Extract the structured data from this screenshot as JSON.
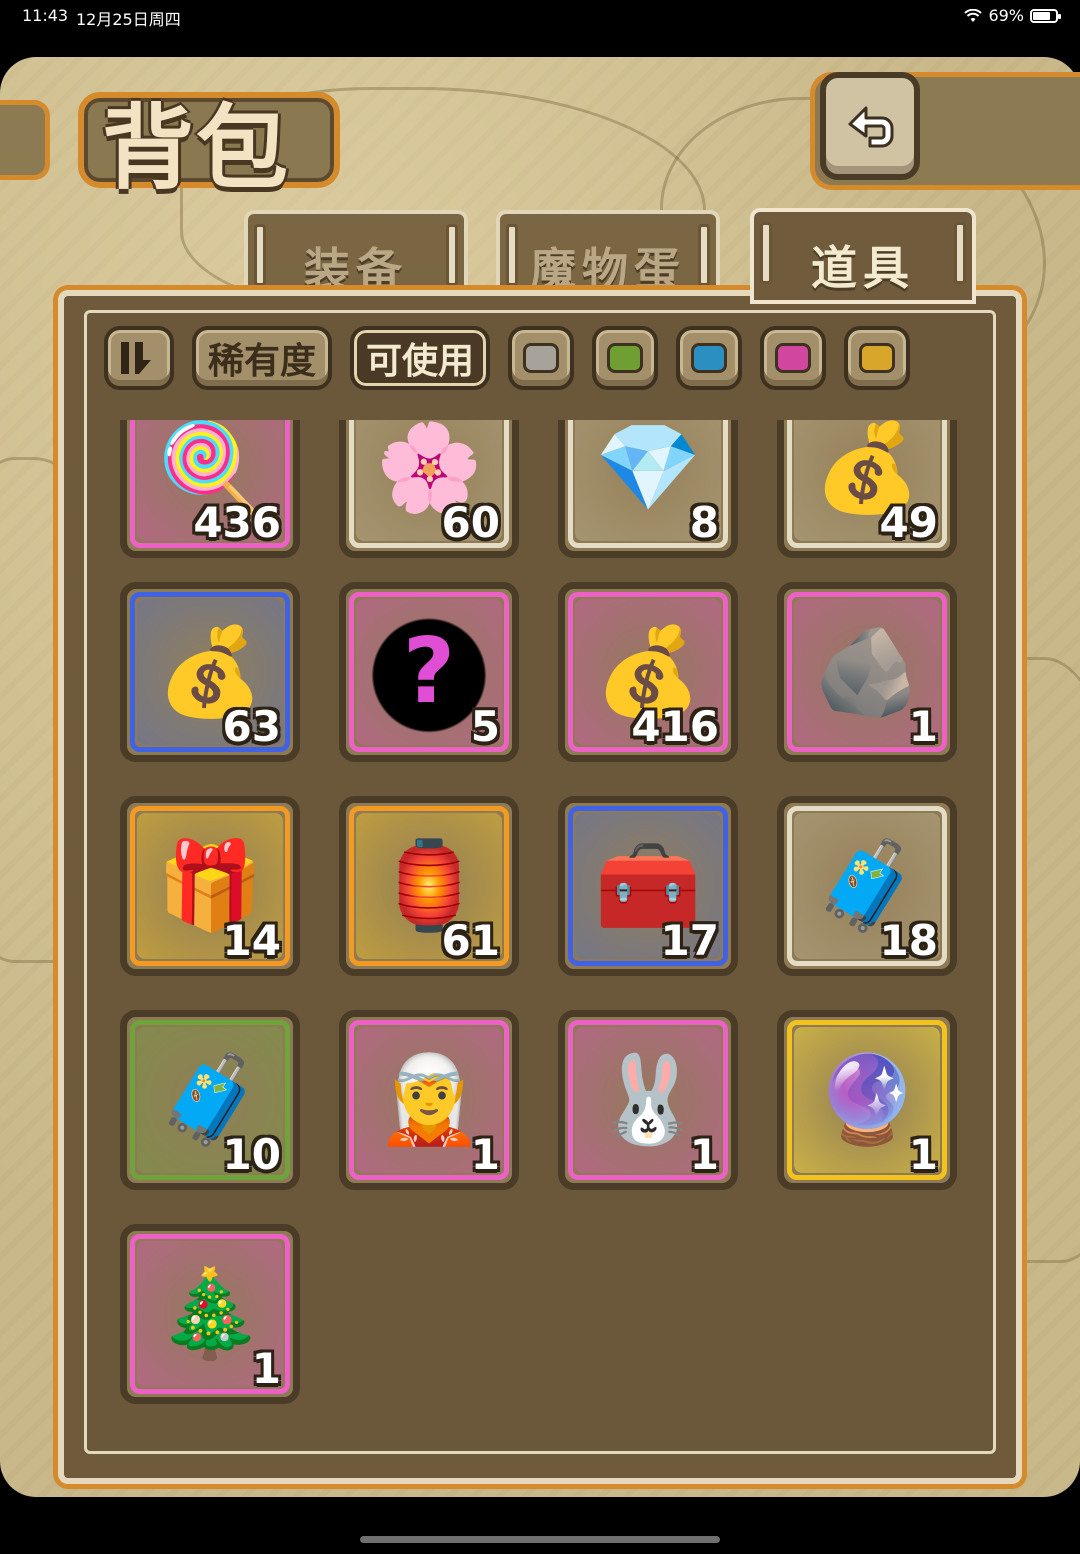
{
  "status_bar": {
    "time": "11:43",
    "date": "12月25日周四",
    "battery": "69%",
    "battery_level": 0.69
  },
  "header": {
    "title": "背包",
    "back_button": "back-arrow-icon"
  },
  "tabs": [
    {
      "label": "装备",
      "active": false
    },
    {
      "label": "魔物蛋",
      "active": false
    },
    {
      "label": "道具",
      "active": true
    }
  ],
  "filters": {
    "sort_icon": "sort-toggle-icon",
    "rarity_label": "稀有度",
    "usable_label": "可使用",
    "usable_active": true,
    "rarity_colors": [
      "#a7a39a",
      "#6f9f33",
      "#2c8fc2",
      "#d1479f",
      "#d8a62a"
    ]
  },
  "items": [
    {
      "name": "rainbow-popsicle",
      "icon": "popsicle-icon",
      "glyph": "🍭",
      "count": "436",
      "rarity": "pink"
    },
    {
      "name": "pink-petal",
      "icon": "petal-icon",
      "glyph": "🌸",
      "count": "60",
      "rarity": "white"
    },
    {
      "name": "purple-crystal",
      "icon": "crystal-icon",
      "glyph": "💎",
      "count": "8",
      "rarity": "white"
    },
    {
      "name": "coin-sack",
      "icon": "coin-sack-icon",
      "glyph": "💰",
      "count": "49",
      "rarity": "white"
    },
    {
      "name": "gold-bag",
      "icon": "gold-bag-icon",
      "glyph": "💰",
      "count": "63",
      "rarity": "blue"
    },
    {
      "name": "mystery-silhouette",
      "icon": "mystery-icon",
      "glyph": "?",
      "count": "5",
      "rarity": "pink"
    },
    {
      "name": "large-gold-bag",
      "icon": "large-gold-bag-icon",
      "glyph": "💰",
      "count": "416",
      "rarity": "pink"
    },
    {
      "name": "purple-ore",
      "icon": "ore-icon",
      "glyph": "🪨",
      "count": "1",
      "rarity": "pink"
    },
    {
      "name": "ghost-box",
      "icon": "ghost-box-icon",
      "glyph": "🎁",
      "count": "14",
      "rarity": "orange"
    },
    {
      "name": "winged-lantern",
      "icon": "lantern-icon",
      "glyph": "🏮",
      "count": "61",
      "rarity": "orange"
    },
    {
      "name": "blue-chest",
      "icon": "blue-chest-icon",
      "glyph": "🧰",
      "count": "17",
      "rarity": "blue"
    },
    {
      "name": "wooden-chest",
      "icon": "wood-chest-icon",
      "glyph": "🧳",
      "count": "18",
      "rarity": "white"
    },
    {
      "name": "wood-chest-green",
      "icon": "chest-icon",
      "glyph": "🧳",
      "count": "10",
      "rarity": "green"
    },
    {
      "name": "demon-maid-figure",
      "icon": "figure-icon",
      "glyph": "🧝",
      "count": "1",
      "rarity": "pink"
    },
    {
      "name": "bunny-angel-figure",
      "icon": "figure-icon",
      "glyph": "🐰",
      "count": "1",
      "rarity": "pink"
    },
    {
      "name": "crystal-girl-figure",
      "icon": "figure-icon",
      "glyph": "🔮",
      "count": "1",
      "rarity": "gold"
    },
    {
      "name": "christmas-girl-figure",
      "icon": "figure-icon",
      "glyph": "🎄",
      "count": "1",
      "rarity": "pink"
    }
  ]
}
